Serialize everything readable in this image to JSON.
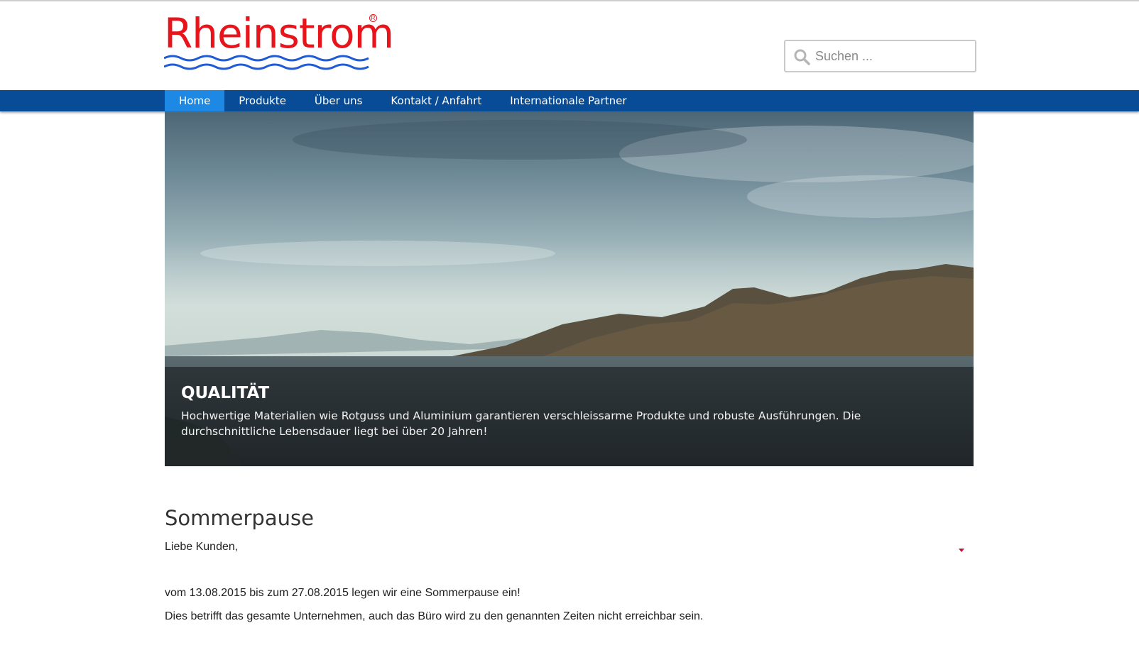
{
  "header": {
    "logo_text": "Rheinstrom",
    "logo_registered": "R",
    "search": {
      "placeholder": "Suchen ..."
    }
  },
  "nav": {
    "items": [
      {
        "label": "Home",
        "active": true
      },
      {
        "label": "Produkte"
      },
      {
        "label": "Über uns"
      },
      {
        "label": "Kontakt / Anfahrt"
      },
      {
        "label": "Internationale Partner"
      }
    ]
  },
  "hero": {
    "title": "QUALITÄT",
    "text": "Hochwertige Materialien wie Rotguss und Aluminium garantieren verschleissarme Produkte und robuste Ausführungen. Die durchschnittliche Lebensdauer liegt bei über 20 Jahren!"
  },
  "article": {
    "title": "Sommerpause",
    "paragraphs": [
      "Liebe Kunden,",
      "vom 13.08.2015 bis zum 27.08.2015 legen wir eine Sommerpause ein!",
      "Dies betrifft das gesamte Unternehmen, auch das Büro wird zu den genannten Zeiten nicht erreichbar sein."
    ]
  },
  "colors": {
    "brand_red": "#e8141b",
    "wave_blue": "#1f5bd6",
    "nav_blue": "#084b96",
    "nav_active": "#1e88e5"
  },
  "icons": [
    "search-icon",
    "caret-down-icon"
  ]
}
